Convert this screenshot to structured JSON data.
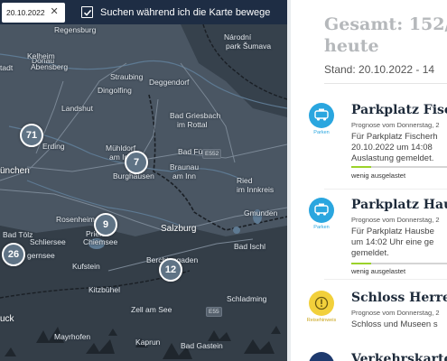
{
  "map": {
    "date_value": "20.10.2022",
    "search_while_moving_label": "Suchen während ich die Karte bewege",
    "search_while_moving_checked": true,
    "places": [
      {
        "id": "regensburg",
        "label": "Regensburg"
      },
      {
        "id": "donau",
        "label": "Donau"
      },
      {
        "id": "narodni",
        "label": "Národní"
      },
      {
        "id": "park-sumava",
        "label": "park Šumava"
      },
      {
        "id": "kelheim",
        "label": "Kelheim"
      },
      {
        "id": "abensberg",
        "label": "Abensberg"
      },
      {
        "id": "straubing",
        "label": "Straubing"
      },
      {
        "id": "deggendorf",
        "label": "Deggendorf"
      },
      {
        "id": "stadt",
        "label": "tadt"
      },
      {
        "id": "dingolfing",
        "label": "Dingolfing"
      },
      {
        "id": "landshut",
        "label": "Landshut"
      },
      {
        "id": "bad-griesbach",
        "label": "Bad Griesbach"
      },
      {
        "id": "im-rottal",
        "label": "im Rottal"
      },
      {
        "id": "erding",
        "label": "Erding"
      },
      {
        "id": "muehldorf",
        "label": "Mühldorf"
      },
      {
        "id": "am-inn",
        "label": "am Inn"
      },
      {
        "id": "bad-fuessing",
        "label": "Bad Füssing"
      },
      {
        "id": "muenchen",
        "label": "ünchen"
      },
      {
        "id": "burghausen",
        "label": "Burghausen"
      },
      {
        "id": "braunau",
        "label": "Braunau"
      },
      {
        "id": "am-inn-2",
        "label": "am Inn"
      },
      {
        "id": "ried",
        "label": "Ried"
      },
      {
        "id": "im-innkreis",
        "label": "im Innkreis"
      },
      {
        "id": "rosenheim",
        "label": "Rosenheim"
      },
      {
        "id": "gmunden",
        "label": "Gmunden"
      },
      {
        "id": "bad-toelz",
        "label": "Bad Tölz"
      },
      {
        "id": "prien",
        "label": "Prien"
      },
      {
        "id": "schliersee",
        "label": "Schliersee"
      },
      {
        "id": "chiemsee",
        "label": "Chiemsee"
      },
      {
        "id": "salzburg",
        "label": "Salzburg"
      },
      {
        "id": "bad-ischl",
        "label": "Bad Ischl"
      },
      {
        "id": "gernsee",
        "label": "gernsee"
      },
      {
        "id": "kufstein",
        "label": "Kufstein"
      },
      {
        "id": "berchtesgaden",
        "label": "Berchtesgaden"
      },
      {
        "id": "kitzbuehel",
        "label": "Kitzbühel"
      },
      {
        "id": "schladming",
        "label": "Schladming"
      },
      {
        "id": "zell-am-see",
        "label": "Zell am See"
      },
      {
        "id": "uck",
        "label": "uck"
      },
      {
        "id": "mayrhofen",
        "label": "Mayrhofen"
      },
      {
        "id": "kaprun",
        "label": "Kaprun"
      },
      {
        "id": "bad-gastein",
        "label": "Bad Gastein"
      }
    ],
    "road_badges": [
      {
        "id": "e552",
        "label": "E552"
      },
      {
        "id": "e55",
        "label": "E55"
      }
    ],
    "clusters": [
      {
        "id": "erding",
        "count": "71"
      },
      {
        "id": "burghausen",
        "count": "7"
      },
      {
        "id": "rosenheim",
        "count": "9"
      },
      {
        "id": "tegernsee",
        "count": "26"
      },
      {
        "id": "berchtesgaden",
        "count": "12"
      }
    ]
  },
  "panel": {
    "title_line1": "Gesamt: 152/",
    "title_line2": "heute",
    "stand": "Stand: 20.10.2022 - 14",
    "items": [
      {
        "icon": "parking-icon",
        "icon_label": "Parken",
        "title": "Parkplatz Fisch",
        "subtitle": "Prognose vom Donnerstag, 2",
        "body_lines": [
          "Für Parkplatz Fischerh",
          "20.10.2022 um 14:08",
          "Auslastung gemeldet."
        ],
        "occupancy_label": "wenig ausgelastet",
        "occupancy_fraction": 0.2
      },
      {
        "icon": "parking-icon",
        "icon_label": "Parken",
        "title": "Parkplatz Haus",
        "subtitle": "Prognose vom Donnerstag, 2",
        "body_lines": [
          "Für Parkplatz Hausbe",
          "um 14:02 Uhr eine ge",
          "gemeldet."
        ],
        "occupancy_label": "wenig ausgelastet",
        "occupancy_fraction": 0.2
      },
      {
        "icon": "info-icon",
        "icon_label": "Reisehinweis",
        "title": "Schloss Herre",
        "subtitle": "Prognose vom Donnerstag, 2",
        "body_lines": [
          "Schloss und Museen s"
        ]
      },
      {
        "icon": "traffic-icon",
        "title": "Verkehrskarte"
      }
    ]
  },
  "colors": {
    "map_bg": "#3f4b58",
    "top_bar": "#1e2d44",
    "parking_blue": "#2aa6df",
    "notice_yellow": "#f2d03b",
    "occupancy_green": "#9bd22a",
    "title_grey": "#b5b8bb",
    "heading_dark": "#1d2a3a"
  }
}
